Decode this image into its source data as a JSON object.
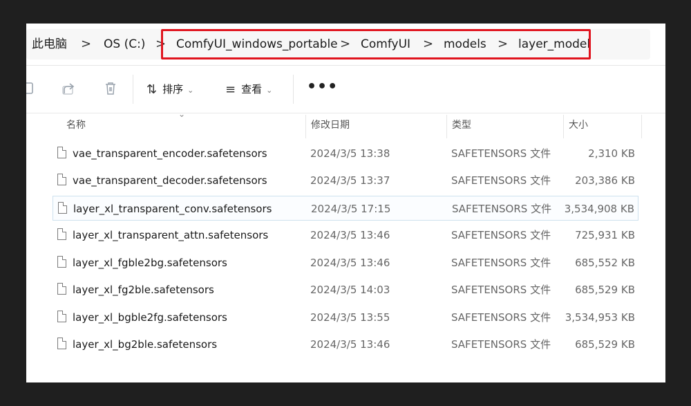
{
  "breadcrumb": {
    "items": [
      "此电脑",
      "OS (C:)",
      "ComfyUI_windows_portable",
      "ComfyUI",
      "models",
      "layer_model"
    ],
    "separator": ">"
  },
  "toolbar": {
    "sort_label": "排序",
    "view_label": "查看",
    "more_label": "•••"
  },
  "columns": {
    "name": "名称",
    "date": "修改日期",
    "type": "类型",
    "size": "大小"
  },
  "files": [
    {
      "name": "vae_transparent_encoder.safetensors",
      "date": "2024/3/5 13:38",
      "type": "SAFETENSORS 文件",
      "size": "2,310 KB"
    },
    {
      "name": "vae_transparent_decoder.safetensors",
      "date": "2024/3/5 13:37",
      "type": "SAFETENSORS 文件",
      "size": "203,386 KB"
    },
    {
      "name": "layer_xl_transparent_conv.safetensors",
      "date": "2024/3/5 17:15",
      "type": "SAFETENSORS 文件",
      "size": "3,534,908 KB"
    },
    {
      "name": "layer_xl_transparent_attn.safetensors",
      "date": "2024/3/5 13:46",
      "type": "SAFETENSORS 文件",
      "size": "725,931 KB"
    },
    {
      "name": "layer_xl_fgble2bg.safetensors",
      "date": "2024/3/5 13:46",
      "type": "SAFETENSORS 文件",
      "size": "685,552 KB"
    },
    {
      "name": "layer_xl_fg2ble.safetensors",
      "date": "2024/3/5 14:03",
      "type": "SAFETENSORS 文件",
      "size": "685,529 KB"
    },
    {
      "name": "layer_xl_bgble2fg.safetensors",
      "date": "2024/3/5 13:55",
      "type": "SAFETENSORS 文件",
      "size": "3,534,953 KB"
    },
    {
      "name": "layer_xl_bg2ble.safetensors",
      "date": "2024/3/5 13:46",
      "type": "SAFETENSORS 文件",
      "size": "685,529 KB"
    }
  ],
  "selected_index": 2,
  "colors": {
    "highlight_border": "#e0141e",
    "selection_border": "#cde1ee",
    "background": "#1f1f1f"
  },
  "icons": {
    "copy": "copy-icon",
    "share": "share-icon",
    "delete": "trash-icon",
    "sort": "sort-arrows-icon",
    "view": "view-lines-icon",
    "more": "more-dots-icon",
    "file": "file-icon"
  }
}
